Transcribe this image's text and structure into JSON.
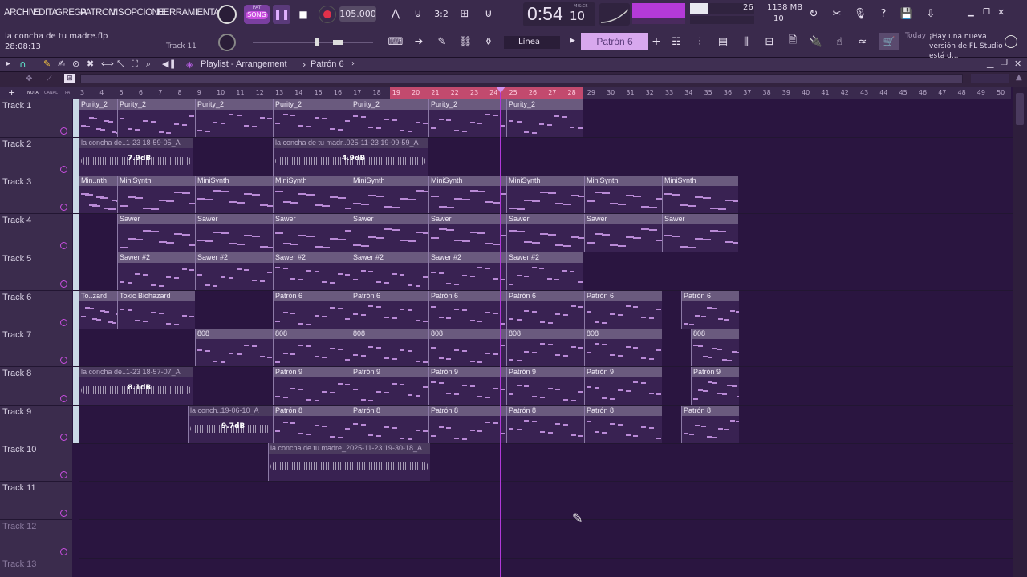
{
  "menu": [
    "ARCHIV",
    "EDITA",
    "GREGA",
    "PATRON",
    "VIS",
    "OPCIONE",
    "HERRAMIENTA"
  ],
  "transport": {
    "mode_label": "SONG",
    "mode_top": "PAT",
    "tempo": "105.000",
    "time": "0:54",
    "time_ticks": "10",
    "time_unit": "M:S:CS"
  },
  "cpu": {
    "value": "26",
    "memory": "1138 MB",
    "polyphony": "10"
  },
  "project": {
    "file": "la concha de tu madre.flp",
    "time": "28:08:13",
    "hint_track": "Track 11"
  },
  "toolbar2": {
    "snap": "Línea",
    "pattern": "Patrón 6"
  },
  "news": {
    "label": "Today",
    "text": "¡Hay una nueva versión de FL Studio está d..."
  },
  "playlist": {
    "title": "Playlist - Arrangement",
    "sep": "›",
    "pattern": "Patrón 6"
  },
  "ruler_labels": {
    "nota": "NOTA",
    "canal": "CANAL",
    "pat": "PAT"
  },
  "ruler": [
    "3",
    "4",
    "5",
    "6",
    "7",
    "8",
    "9",
    "10",
    "11",
    "12",
    "13",
    "14",
    "15",
    "16",
    "17",
    "18",
    "19",
    "20",
    "21",
    "22",
    "23",
    "24",
    "25",
    "26",
    "27",
    "28",
    "29",
    "30",
    "31",
    "32",
    "33",
    "34",
    "35",
    "36",
    "37",
    "38",
    "39",
    "40",
    "41",
    "42",
    "43",
    "44",
    "45",
    "46",
    "47",
    "48",
    "49",
    "50"
  ],
  "tracks": [
    {
      "name": "Track 1",
      "clips": [
        {
          "l": "Purity_2"
        },
        {
          "l": "Purity_2"
        },
        {
          "l": "Purity_2"
        },
        {
          "l": "Purity_2"
        },
        {
          "l": "Purity_2"
        },
        {
          "l": "Purity_2"
        },
        {
          "l": "Purity_2"
        }
      ]
    },
    {
      "name": "Track 2",
      "clips": [
        {
          "l": "la concha de..1-23 18-59-05_A",
          "db": "7.9dB"
        },
        {
          "l": "la concha de tu madr..025-11-23 19-09-59_A",
          "db": "4.9dB"
        }
      ]
    },
    {
      "name": "Track 3",
      "clips": [
        {
          "l": "Min..nth"
        },
        {
          "l": "MiniSynth"
        },
        {
          "l": "MiniSynth"
        },
        {
          "l": "MiniSynth"
        },
        {
          "l": "MiniSynth"
        },
        {
          "l": "MiniSynth"
        },
        {
          "l": "MiniSynth"
        },
        {
          "l": "MiniSynth"
        },
        {
          "l": "MiniSynth"
        }
      ]
    },
    {
      "name": "Track 4",
      "clips": [
        {
          "l": "Sawer"
        },
        {
          "l": "Sawer"
        },
        {
          "l": "Sawer"
        },
        {
          "l": "Sawer"
        },
        {
          "l": "Sawer"
        },
        {
          "l": "Sawer"
        },
        {
          "l": "Sawer"
        },
        {
          "l": "Sawer"
        }
      ]
    },
    {
      "name": "Track 5",
      "clips": [
        {
          "l": "Sawer #2"
        },
        {
          "l": "Sawer #2"
        },
        {
          "l": "Sawer #2"
        },
        {
          "l": "Sawer #2"
        },
        {
          "l": "Sawer #2"
        },
        {
          "l": "Sawer #2"
        }
      ]
    },
    {
      "name": "Track 6",
      "clips": [
        {
          "l": "To..zard"
        },
        {
          "l": "Toxic Biohazard"
        },
        {
          "l": "Patrón 6"
        },
        {
          "l": "Patrón 6"
        },
        {
          "l": "Patrón 6"
        },
        {
          "l": "Patrón 6"
        },
        {
          "l": "Patrón 6"
        },
        {
          "l": "Patrón 6"
        }
      ]
    },
    {
      "name": "Track 7",
      "clips": [
        {
          "l": "808"
        },
        {
          "l": "808"
        },
        {
          "l": "808"
        },
        {
          "l": "808"
        },
        {
          "l": "808"
        },
        {
          "l": "808"
        },
        {
          "l": "808"
        }
      ]
    },
    {
      "name": "Track 8",
      "clips": [
        {
          "l": "la concha de..1-23 18-57-07_A",
          "db": "8.1dB"
        },
        {
          "l": "Patrón 9"
        },
        {
          "l": "Patrón 9"
        },
        {
          "l": "Patrón 9"
        },
        {
          "l": "Patrón 9"
        },
        {
          "l": "Patrón 9"
        },
        {
          "l": "Patrón 9"
        }
      ]
    },
    {
      "name": "Track 9",
      "clips": [
        {
          "l": "la conch..19-06-10_A",
          "db": "9.7dB"
        },
        {
          "l": "Patrón 8"
        },
        {
          "l": "Patrón 8"
        },
        {
          "l": "Patrón 8"
        },
        {
          "l": "Patrón 8"
        },
        {
          "l": "Patrón 8"
        },
        {
          "l": "Patrón 8"
        }
      ]
    },
    {
      "name": "Track 10",
      "clips": [
        {
          "l": "la concha de tu madre_2025-11-23 19-30-18_A"
        }
      ]
    },
    {
      "name": "Track 11",
      "clips": []
    },
    {
      "name": "Track 12",
      "clips": []
    },
    {
      "name": "Track 13",
      "clips": []
    }
  ]
}
